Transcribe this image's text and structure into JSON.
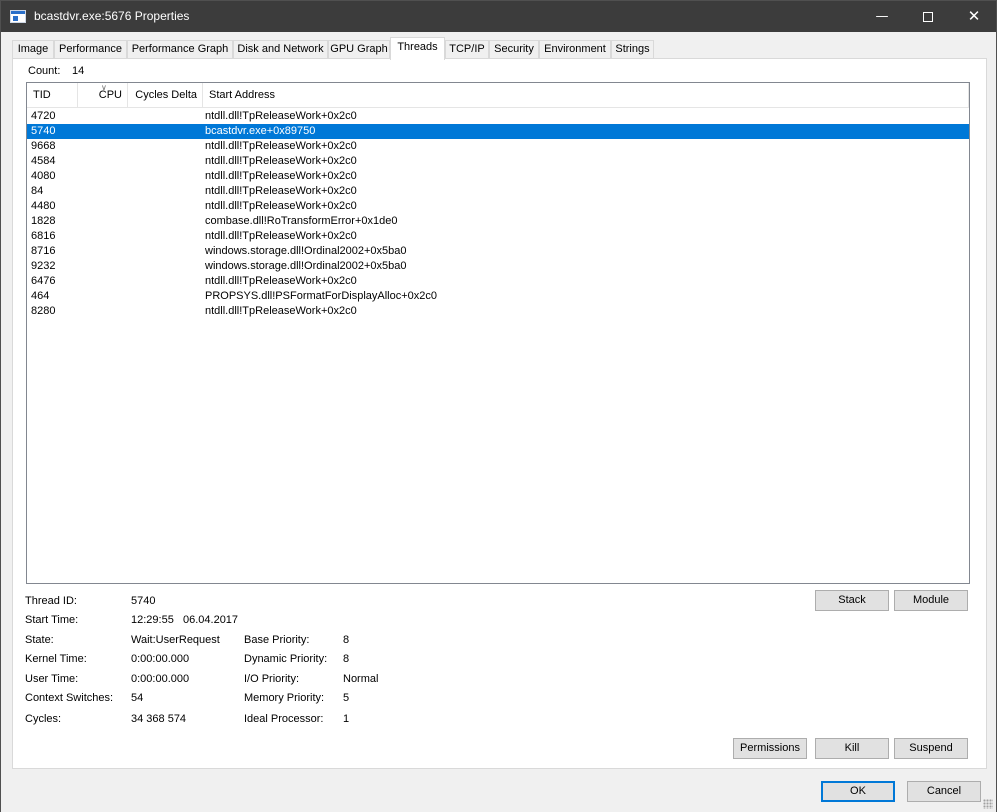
{
  "window": {
    "title": "bcastdvr.exe:5676 Properties",
    "icon": "window-properties-icon",
    "controls": {
      "minimize": "—",
      "close": "✕"
    }
  },
  "tabs": [
    {
      "label": "Image"
    },
    {
      "label": "Performance"
    },
    {
      "label": "Performance Graph"
    },
    {
      "label": "Disk and Network"
    },
    {
      "label": "GPU Graph"
    },
    {
      "label": "Threads",
      "active": true
    },
    {
      "label": "TCP/IP"
    },
    {
      "label": "Security"
    },
    {
      "label": "Environment"
    },
    {
      "label": "Strings"
    }
  ],
  "threads": {
    "count_label": "Count:",
    "count_value": "14",
    "columns": {
      "tid": "TID",
      "cpu": "CPU",
      "cycles_delta": "Cycles Delta",
      "start_address": "Start Address"
    },
    "sorted_column": "CPU",
    "rows": [
      {
        "tid": "4720",
        "start_address": "ntdll.dll!TpReleaseWork+0x2c0"
      },
      {
        "tid": "5740",
        "start_address": "bcastdvr.exe+0x89750",
        "selected": true
      },
      {
        "tid": "9668",
        "start_address": "ntdll.dll!TpReleaseWork+0x2c0"
      },
      {
        "tid": "4584",
        "start_address": "ntdll.dll!TpReleaseWork+0x2c0"
      },
      {
        "tid": "4080",
        "start_address": "ntdll.dll!TpReleaseWork+0x2c0"
      },
      {
        "tid": "84",
        "start_address": "ntdll.dll!TpReleaseWork+0x2c0"
      },
      {
        "tid": "4480",
        "start_address": "ntdll.dll!TpReleaseWork+0x2c0"
      },
      {
        "tid": "1828",
        "start_address": "combase.dll!RoTransformError+0x1de0"
      },
      {
        "tid": "6816",
        "start_address": "ntdll.dll!TpReleaseWork+0x2c0"
      },
      {
        "tid": "8716",
        "start_address": "windows.storage.dll!Ordinal2002+0x5ba0"
      },
      {
        "tid": "9232",
        "start_address": "windows.storage.dll!Ordinal2002+0x5ba0"
      },
      {
        "tid": "6476",
        "start_address": "ntdll.dll!TpReleaseWork+0x2c0"
      },
      {
        "tid": "464",
        "start_address": "PROPSYS.dll!PSFormatForDisplayAlloc+0x2c0"
      },
      {
        "tid": "8280",
        "start_address": "ntdll.dll!TpReleaseWork+0x2c0"
      }
    ]
  },
  "details": {
    "thread_id": {
      "label": "Thread ID:",
      "value": "5740"
    },
    "start_time": {
      "label": "Start Time:",
      "value": "12:29:55   06.04.2017"
    },
    "state": {
      "label": "State:",
      "value": "Wait:UserRequest"
    },
    "kernel_time": {
      "label": "Kernel Time:",
      "value": "0:00:00.000"
    },
    "user_time": {
      "label": "User Time:",
      "value": "0:00:00.000"
    },
    "context_switches": {
      "label": "Context Switches:",
      "value": "54"
    },
    "cycles": {
      "label": "Cycles:",
      "value": "34 368 574"
    },
    "base_priority": {
      "label": "Base Priority:",
      "value": "8"
    },
    "dynamic_priority": {
      "label": "Dynamic Priority:",
      "value": "8"
    },
    "io_priority": {
      "label": "I/O Priority:",
      "value": "Normal"
    },
    "memory_priority": {
      "label": "Memory Priority:",
      "value": "5"
    },
    "ideal_processor": {
      "label": "Ideal Processor:",
      "value": "1"
    }
  },
  "buttons": {
    "stack": "Stack",
    "module": "Module",
    "permissions": "Permissions",
    "kill": "Kill",
    "suspend": "Suspend",
    "ok": "OK",
    "cancel": "Cancel"
  },
  "colors": {
    "selection": "#0078d7",
    "titlebar": "#3c3c3c"
  }
}
